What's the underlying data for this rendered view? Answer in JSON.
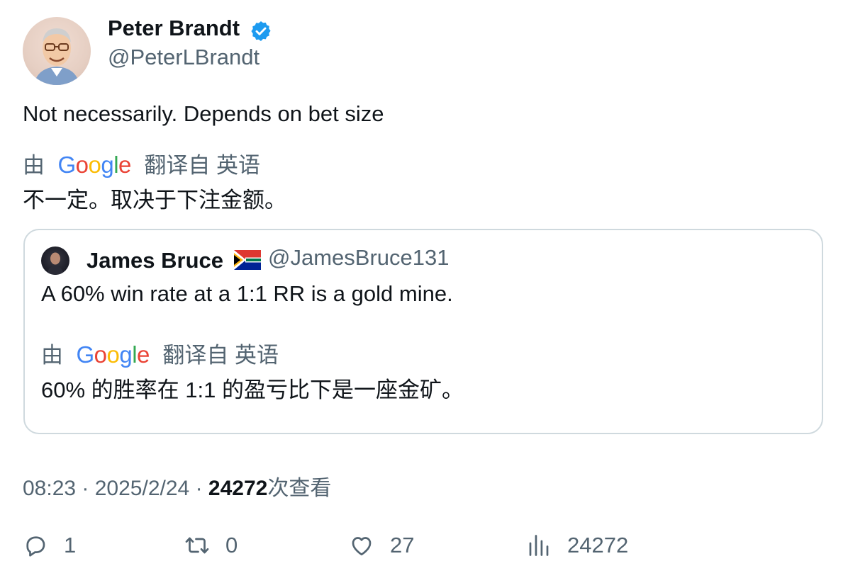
{
  "tweet": {
    "author_name": "Peter Brandt",
    "author_handle": "@PeterLBrandt",
    "text": "Not necessarily. Depends on bet size",
    "translation": {
      "by": "由",
      "provider": "Google",
      "from": "翻译自 英语",
      "text": "不一定。取决于下注金额。"
    },
    "time": "08:23",
    "date": "2025/2/24",
    "views": "24272",
    "views_label": "次查看"
  },
  "quote": {
    "author_name": "James Bruce",
    "author_handle": "@JamesBruce131",
    "text": "A 60% win rate at a 1:1 RR is a gold mine.",
    "translation": {
      "by": "由",
      "provider": "Google",
      "from": "翻译自 英语",
      "text": "60% 的胜率在 1:1 的盈亏比下是一座金矿。"
    }
  },
  "actions": {
    "reply_count": "1",
    "retweet_count": "0",
    "like_count": "27",
    "views_count": "24272"
  },
  "icons": {
    "verified": "verified-badge-icon",
    "reply": "reply-icon",
    "retweet": "retweet-icon",
    "like": "heart-icon",
    "views": "bar-chart-icon",
    "flag": "south-africa-flag-icon"
  },
  "colors": {
    "verified_blue": "#1d9bf0",
    "text_primary": "#0f1419",
    "text_secondary": "#536471",
    "border": "#cfd9de"
  }
}
